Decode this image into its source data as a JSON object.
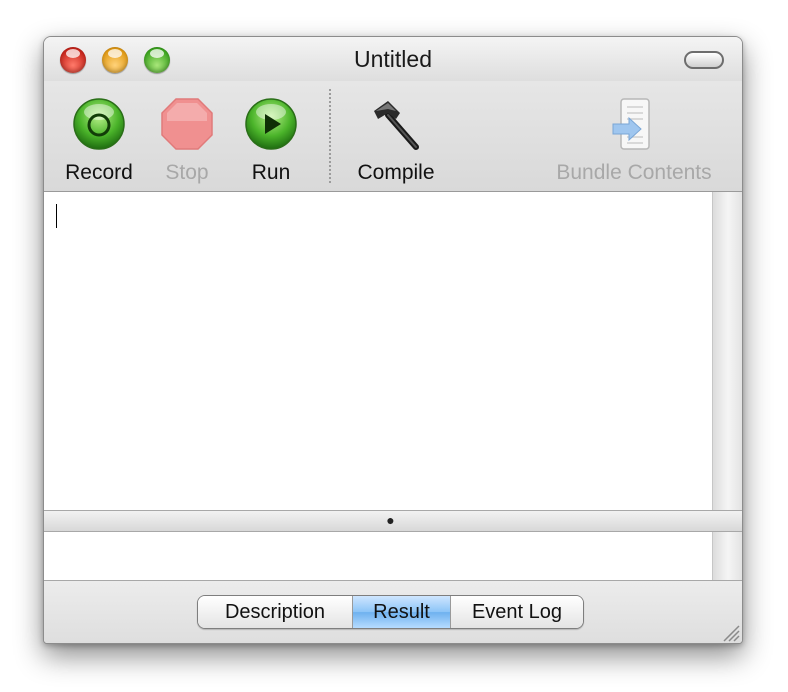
{
  "window": {
    "title": "Untitled"
  },
  "toolbar": {
    "items": [
      {
        "label": "Record",
        "icon": "record-icon",
        "enabled": true
      },
      {
        "label": "Stop",
        "icon": "stop-icon",
        "enabled": false
      },
      {
        "label": "Run",
        "icon": "run-icon",
        "enabled": true
      },
      {
        "label": "Compile",
        "icon": "hammer-icon",
        "enabled": true
      },
      {
        "label": "Bundle Contents",
        "icon": "bundle-contents-icon",
        "enabled": false
      }
    ]
  },
  "editor": {
    "text": ""
  },
  "bottom_tabs": {
    "items": [
      {
        "label": "Description",
        "selected": false
      },
      {
        "label": "Result",
        "selected": true
      },
      {
        "label": "Event Log",
        "selected": false
      }
    ]
  },
  "colors": {
    "record_green": "#3ca51f",
    "stop_red": "#f08a8a",
    "run_green": "#3ca51f",
    "selected_tab_blue": "#8cc4f7"
  }
}
